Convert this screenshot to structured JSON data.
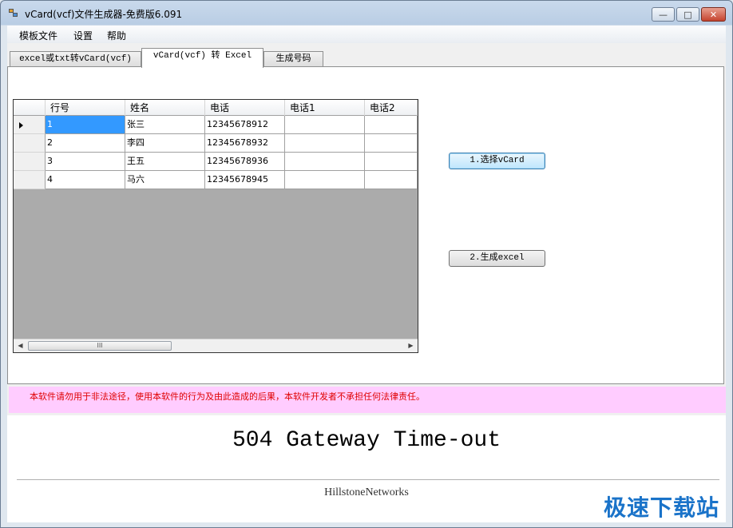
{
  "window": {
    "title": "vCard(vcf)文件生成器-免费版6.091",
    "min_label": "▭",
    "max_label": "▢",
    "close_label": "✕"
  },
  "menu": {
    "items": [
      {
        "label": "模板文件"
      },
      {
        "label": "设置"
      },
      {
        "label": "帮助"
      }
    ]
  },
  "tabs": [
    {
      "label": "excel或txt转vCard(vcf)",
      "active": false
    },
    {
      "label": "vCard(vcf) 转 Excel",
      "active": true
    },
    {
      "label": "生成号码",
      "active": false
    }
  ],
  "grid": {
    "columns": [
      "行号",
      "姓名",
      "电话",
      "电话1",
      "电话2"
    ],
    "rows": [
      [
        "1",
        "张三",
        "12345678912",
        "",
        ""
      ],
      [
        "2",
        "李四",
        "12345678932",
        "",
        ""
      ],
      [
        "3",
        "王五",
        "12345678936",
        "",
        ""
      ],
      [
        "4",
        "马六",
        "12345678945",
        "",
        ""
      ]
    ],
    "scroll_thumb_label": "III"
  },
  "buttons": {
    "select_vcard": "1.选择vCard",
    "generate_excel": "2.生成excel"
  },
  "warning_text": "本软件请勿用于非法途径，使用本软件的行为及由此造成的后果，本软件开发者不承担任何法律责任。",
  "error_page": {
    "title": "504 Gateway Time-out",
    "footer": "HillstoneNetworks"
  },
  "watermark": "极速下载站",
  "colors": {
    "selected_cell": "#3399ff",
    "warning_bg": "#ffccff",
    "warning_text": "#e00000",
    "watermark": "#1a73c9"
  }
}
